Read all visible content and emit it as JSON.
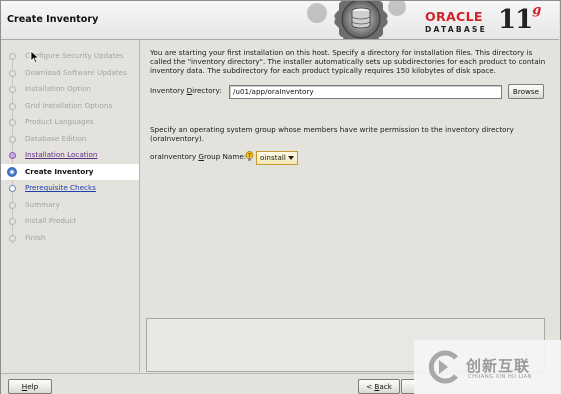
{
  "header": {
    "title": "Create Inventory",
    "brand": "ORACLE",
    "product": "DATABASE",
    "version": "11",
    "version_suffix": "g",
    "brand_color": "#d2232a"
  },
  "nav": {
    "steps": [
      {
        "label": "Configure Security Updates",
        "state": "done"
      },
      {
        "label": "Download Software Updates",
        "state": "done"
      },
      {
        "label": "Installation Option",
        "state": "done"
      },
      {
        "label": "Grid Installation Options",
        "state": "done"
      },
      {
        "label": "Product Languages",
        "state": "done"
      },
      {
        "label": "Database Edition",
        "state": "done"
      },
      {
        "label": "Installation Location",
        "state": "visited"
      },
      {
        "label": "Create Inventory",
        "state": "current"
      },
      {
        "label": "Prerequisite Checks",
        "state": "next"
      },
      {
        "label": "Summary",
        "state": "pending"
      },
      {
        "label": "Install Product",
        "state": "pending"
      },
      {
        "label": "Finish",
        "state": "pending"
      }
    ]
  },
  "main": {
    "intro_text": "You are starting your first installation on this host. Specify a directory for installation files. This directory is called the \"inventory directory\". The installer automatically sets up subdirectories for each product to contain inventory data. The subdirectory for each product typically requires 150 kilobytes of disk space.",
    "inventory_dir_label_prefix": "Inventory ",
    "inventory_dir_label_mnemonic": "D",
    "inventory_dir_label_suffix": "irectory:",
    "inventory_dir_value": "/u01/app/oraInventory",
    "browse_label": "Browse",
    "group_text": "Specify an operating system group whose members have write permission to the inventory directory (oraInventory).",
    "group_label_prefix": "oraInventory ",
    "group_label_mnemonic": "G",
    "group_label_suffix": "roup Name:",
    "group_value": "oinstall"
  },
  "footer": {
    "help_label_mnemonic": "H",
    "help_label_rest": "elp",
    "back_label_prefix": "< ",
    "back_label_mnemonic": "B",
    "back_label_rest": "ack"
  },
  "watermark": {
    "cn_text": "创新互联",
    "en_text": "CHUANG XIN HU LIAN"
  }
}
